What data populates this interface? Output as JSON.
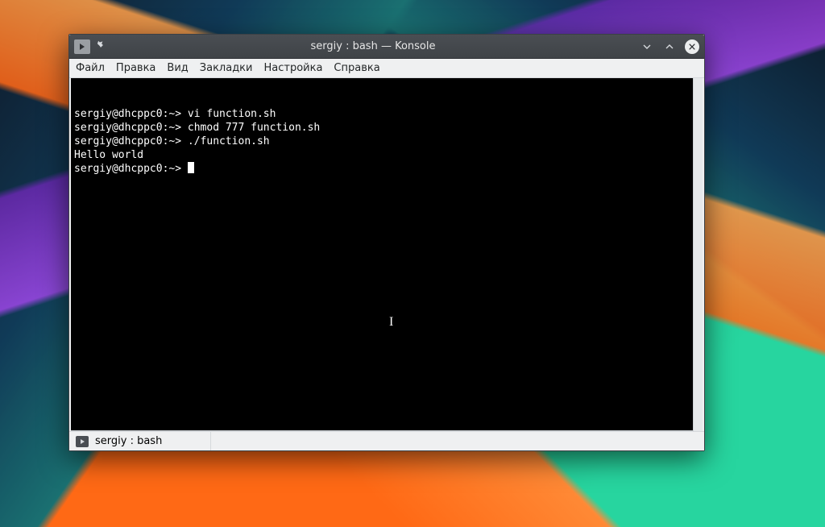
{
  "titlebar": {
    "title": "sergiy : bash — Konsole"
  },
  "menu": {
    "file": "Файл",
    "edit": "Правка",
    "view": "Вид",
    "bookmarks": "Закладки",
    "settings": "Настройка",
    "help": "Справка"
  },
  "terminal": {
    "lines": [
      {
        "prompt": "sergiy@dhcppc0:~> ",
        "cmd": "vi function.sh"
      },
      {
        "prompt": "sergiy@dhcppc0:~> ",
        "cmd": "chmod 777 function.sh"
      },
      {
        "prompt": "sergiy@dhcppc0:~> ",
        "cmd": "./function.sh"
      },
      {
        "out": "Hello world"
      },
      {
        "prompt": "sergiy@dhcppc0:~> ",
        "cursor": true
      }
    ]
  },
  "tab": {
    "label": "sergiy : bash"
  }
}
